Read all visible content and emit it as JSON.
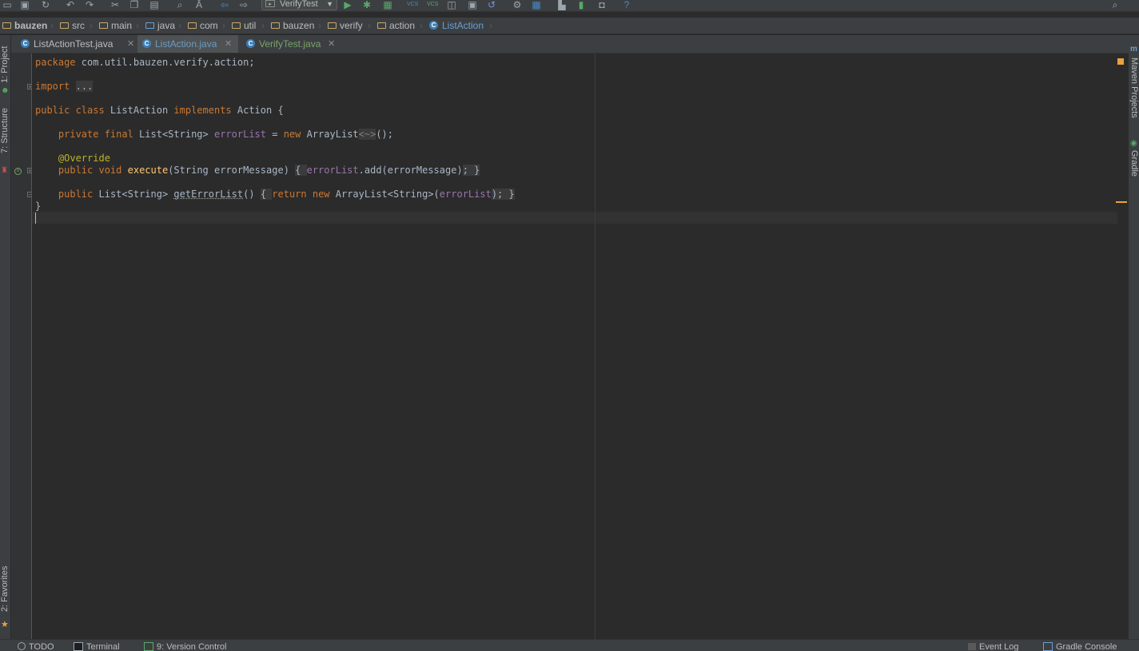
{
  "toolbar": {
    "run_config_label": "VerifyTest",
    "icons": [
      "open-icon",
      "save-icon",
      "sync-icon",
      "undo-icon",
      "redo-icon",
      "cut-icon",
      "copy-icon",
      "paste-icon",
      "find-icon",
      "replace-icon",
      "back-icon",
      "forward-icon",
      "run-config-select",
      "run-icon",
      "debug-icon",
      "coverage-icon",
      "vcs-update-icon",
      "vcs-commit-icon",
      "compare-icon",
      "history-icon",
      "revert-icon",
      "settings-icon",
      "project-structure-icon",
      "sdk-manager-icon",
      "avd-manager-icon",
      "android-icon",
      "help-icon",
      "search-everywhere-icon"
    ],
    "vcs_label": "VCS"
  },
  "breadcrumb": {
    "items": [
      "bauzen",
      "src",
      "main",
      "java",
      "com",
      "util",
      "bauzen",
      "verify",
      "action"
    ],
    "current_class": "ListAction"
  },
  "tabs": [
    {
      "label": "ListActionTest.java",
      "state": "normal"
    },
    {
      "label": "ListAction.java",
      "state": "active"
    },
    {
      "label": "VerifyTest.java",
      "state": "modified"
    }
  ],
  "left_stripe": {
    "project": "1: Project",
    "structure": "7: Structure",
    "favorites": "2: Favorites"
  },
  "right_stripe": {
    "maven": "Maven Projects",
    "gradle": "Gradle"
  },
  "code": {
    "l1_kw": "package",
    "l1_rest": " com.util.bauzen.verify.action;",
    "l2_kw": "import",
    "l2_fold": "...",
    "l3_kw1": "public class",
    "l3_name": " ListAction ",
    "l3_kw2": "implements",
    "l3_rest": " Action {",
    "l4_kw": "private final",
    "l4_type": " List<String> ",
    "l4_field": "errorList",
    "l4_mid": " = ",
    "l4_new": "new",
    "l4_type2": " ArrayList",
    "l4_diamond": "<~>",
    "l4_end": "();",
    "l5_ann": "@Override",
    "l6_kw": "public void",
    "l6_fn": "execute",
    "l6_params": "(String errorMessage) ",
    "l6_fold1": "{ ",
    "l6_field": "errorList",
    "l6_call": ".add(errorMessage)",
    "l6_fold2": "; }",
    "l7_kw": "public",
    "l7_type": " List<String> ",
    "l7_fn": "getErrorList",
    "l7_params": "() ",
    "l7_fold1": "{ ",
    "l7_ret": "return new",
    "l7_type2": " ArrayList<String>(",
    "l7_field": "errorList",
    "l7_fold2": "); }",
    "l8": "}"
  },
  "statusbar": {
    "todo": "TODO",
    "terminal": "Terminal",
    "vcs": "9: Version Control",
    "event_log": "Event Log",
    "gradle_console": "Gradle Console"
  },
  "colors": {
    "keyword": "#cc7832",
    "field": "#9876aa",
    "annotation": "#bbb529",
    "method": "#ffc66d",
    "text": "#a9b7c6",
    "background": "#2b2b2b",
    "chrome": "#3c3f41",
    "warning_stripe": "#e8a33d"
  }
}
